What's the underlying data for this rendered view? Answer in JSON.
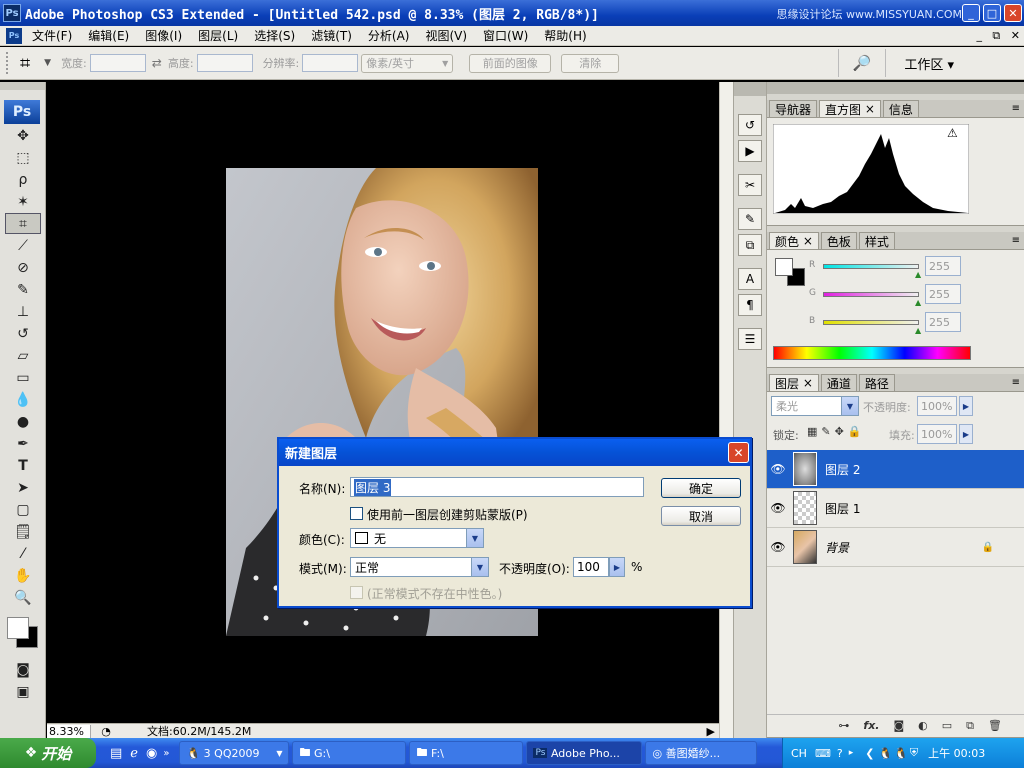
{
  "window": {
    "title": "Adobe Photoshop CS3 Extended - [Untitled 542.psd @ 8.33% (图层 2, RGB/8*)]",
    "app_icon": "Ps",
    "watermark": "思缘设计论坛 www.MISSYUAN.COM"
  },
  "menu": [
    "文件(F)",
    "编辑(E)",
    "图像(I)",
    "图层(L)",
    "选择(S)",
    "滤镜(T)",
    "分析(A)",
    "视图(V)",
    "窗口(W)",
    "帮助(H)"
  ],
  "options": {
    "width_label": "宽度:",
    "height_label": "高度:",
    "resolution_label": "分辨率:",
    "unit": "像素/英寸",
    "front_image_btn": "前面的图像",
    "clear_btn": "清除",
    "workspace_btn": "工作区"
  },
  "toolbox": {
    "logo": "Ps"
  },
  "status": {
    "zoom": "8.33%",
    "doc": "文档:60.2M/145.2M"
  },
  "panels": {
    "group1_tabs": [
      "导航器",
      "直方图",
      "信息"
    ],
    "group2_tabs": [
      "颜色",
      "色板",
      "样式"
    ],
    "color": {
      "channels": [
        {
          "label": "R",
          "value": "255",
          "color": "#00e5e5"
        },
        {
          "label": "G",
          "value": "255",
          "color": "#e020e0"
        },
        {
          "label": "B",
          "value": "255",
          "color": "#e0e000"
        }
      ]
    },
    "group3_tabs": [
      "图层",
      "通道",
      "路径"
    ],
    "layers": {
      "blend_mode": "柔光",
      "opacity_label": "不透明度:",
      "opacity": "100%",
      "lock_label": "锁定:",
      "fill_label": "填充:",
      "fill": "100%",
      "items": [
        {
          "name": "图层 2",
          "selected": true
        },
        {
          "name": "图层 1",
          "selected": false
        },
        {
          "name": "背景",
          "selected": false
        }
      ],
      "footer_fx": "fx."
    }
  },
  "dialog": {
    "title": "新建图层",
    "name_label": "名称(N):",
    "name_value": "图层 3",
    "clip_label": "使用前一图层创建剪贴蒙版(P)",
    "color_label": "颜色(C):",
    "color_value": "无",
    "mode_label": "模式(M):",
    "mode_value": "正常",
    "opacity_label": "不透明度(O):",
    "opacity_value": "100",
    "percent": "%",
    "neutral_label": "(正常模式不存在中性色。)",
    "ok": "确定",
    "cancel": "取消"
  },
  "taskbar": {
    "start": "开始",
    "tasks": [
      "3 QQ2009",
      "G:\\",
      "F:\\",
      "Adobe Pho...",
      "善图婚纱..."
    ],
    "lang": "CH",
    "clock": "上午 00:03"
  }
}
